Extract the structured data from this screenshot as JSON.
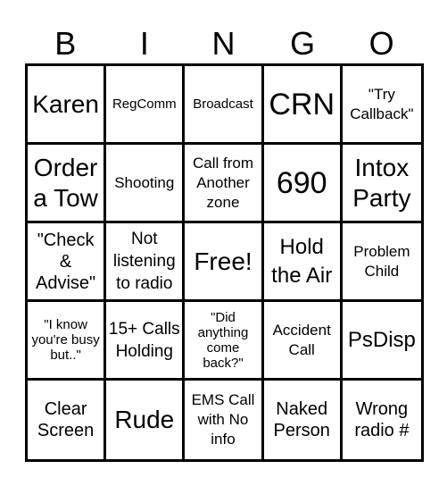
{
  "header": {
    "letters": [
      "B",
      "I",
      "N",
      "G",
      "O"
    ]
  },
  "cells": [
    {
      "text": "Karen",
      "size": "s5"
    },
    {
      "text": "RegComm",
      "size": "s1"
    },
    {
      "text": "Broadcast",
      "size": "s1"
    },
    {
      "text": "CRN",
      "size": "s6"
    },
    {
      "text": "\"Try Callback\"",
      "size": "s2"
    },
    {
      "text": "Order a Tow",
      "size": "s5"
    },
    {
      "text": "Shooting",
      "size": "s2"
    },
    {
      "text": "Call from Another zone",
      "size": "s2"
    },
    {
      "text": "690",
      "size": "s6"
    },
    {
      "text": "Intox Party",
      "size": "s5"
    },
    {
      "text": "\"Check & Advise\"",
      "size": "s7"
    },
    {
      "text": "Not listening to radio",
      "size": "s3"
    },
    {
      "text": "Free!",
      "size": "s5"
    },
    {
      "text": "Hold the Air",
      "size": "s4"
    },
    {
      "text": "Problem Child",
      "size": "s2"
    },
    {
      "text": "\"I know you're busy but..\"",
      "size": "s1"
    },
    {
      "text": "15+ Calls Holding",
      "size": "s3"
    },
    {
      "text": "\"Did anything come back?\"",
      "size": "s1"
    },
    {
      "text": "Accident Call",
      "size": "s2"
    },
    {
      "text": "PsDisp",
      "size": "s4"
    },
    {
      "text": "Clear Screen",
      "size": "s7"
    },
    {
      "text": "Rude",
      "size": "s5"
    },
    {
      "text": "EMS Call with No info",
      "size": "s2"
    },
    {
      "text": "Naked Person",
      "size": "s7"
    },
    {
      "text": "Wrong radio #",
      "size": "s7"
    }
  ]
}
